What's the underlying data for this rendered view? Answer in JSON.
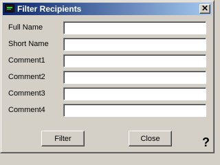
{
  "window": {
    "title": "Filter Recipients",
    "close_glyph": "✕",
    "icon": "terminal-icon"
  },
  "fields": [
    {
      "label": "Full Name",
      "value": ""
    },
    {
      "label": "Short Name",
      "value": ""
    },
    {
      "label": "Comment1",
      "value": ""
    },
    {
      "label": "Comment2",
      "value": ""
    },
    {
      "label": "Comment3",
      "value": ""
    },
    {
      "label": "Comment4",
      "value": ""
    }
  ],
  "buttons": {
    "filter_label": "Filter",
    "close_label": "Close"
  },
  "help": {
    "glyph": "?"
  },
  "colors": {
    "titlebar_start": "#0a246a",
    "titlebar_end": "#a6caf0",
    "face": "#d4d0c8"
  }
}
